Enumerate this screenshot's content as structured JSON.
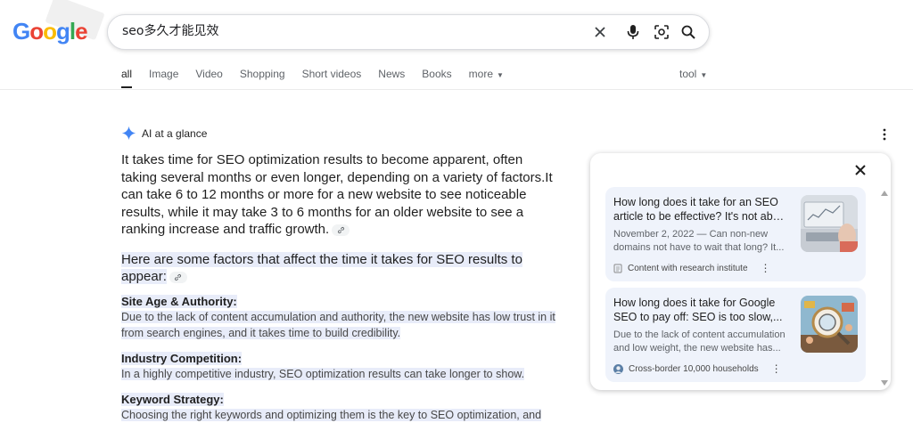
{
  "logo": {
    "text": "Google"
  },
  "search": {
    "query": "seo多久才能见效"
  },
  "tabs": [
    {
      "label": "all",
      "active": true
    },
    {
      "label": "Image"
    },
    {
      "label": "Video"
    },
    {
      "label": "Shopping"
    },
    {
      "label": "Short videos"
    },
    {
      "label": "News"
    },
    {
      "label": "Books"
    },
    {
      "label": "more"
    }
  ],
  "tool_label": "tool",
  "ai": {
    "heading": "AI at a glance",
    "intro": "It takes time for SEO optimization results to become apparent, often taking several months or even longer, depending on a variety of factors.It can take 6 to 12 months or more for a new website to see noticeable results, while it may take 3 to 6 months for an older website to see a ranking increase and traffic growth.",
    "factors_intro": "Here are some factors that affect the time it takes for SEO results to appear:",
    "factors": [
      {
        "title": "Site Age & Authority:",
        "text": "Due to the lack of content accumulation and authority, the new website has low trust in it from search engines, and it takes time to build credibility."
      },
      {
        "title": "Industry Competition:",
        "text": "In a highly competitive industry, SEO optimization results can take longer to show."
      },
      {
        "title": "Keyword Strategy:",
        "text": "Choosing the right keywords and optimizing them is the key to SEO optimization, and"
      }
    ]
  },
  "sources": [
    {
      "title_l1": "How long does it take for an SEO",
      "title_l2": "article to be effective? It's not abo...",
      "snippet_l1": "November 2, 2022 — Can non-new",
      "snippet_l2": "domains not have to wait that long? It...",
      "source": "Content with research institute"
    },
    {
      "title_l1": "How long does it take for Google",
      "title_l2": "SEO to pay off: SEO is too slow,...",
      "snippet_l1": "Due to the lack of content accumulation",
      "snippet_l2": "and low weight, the new website has...",
      "source": "Cross-border 10,000 households"
    }
  ],
  "colors": {
    "accent_blue": "#4285f4",
    "highlight": "#e8ecf9",
    "card_bg": "#eff3fb"
  }
}
